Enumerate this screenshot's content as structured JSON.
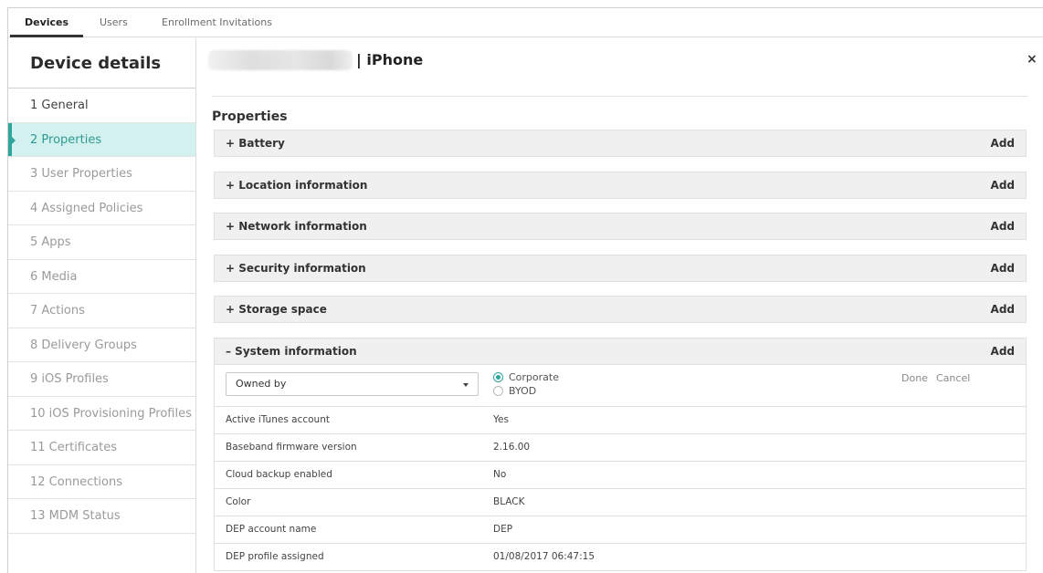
{
  "topnav": {
    "tabs": [
      "Devices",
      "Users",
      "Enrollment Invitations"
    ]
  },
  "sidebar": {
    "title": "Device details",
    "items": [
      "1 General",
      "2 Properties",
      "3 User Properties",
      "4 Assigned Policies",
      "5 Apps",
      "6 Media",
      "7 Actions",
      "8 Delivery Groups",
      "9 iOS Profiles",
      "10 iOS Provisioning Profiles",
      "11 Certificates",
      "12 Connections",
      "13 MDM Status"
    ]
  },
  "header": {
    "title": "| iPhone",
    "close": "×"
  },
  "properties": {
    "title": "Properties",
    "add_label": "Add",
    "sections": [
      "+ Battery",
      "+ Location information",
      "+ Network information",
      "+ Security information",
      "+ Storage space",
      "– System information"
    ],
    "edit": {
      "select_value": "Owned by",
      "radio": [
        "Corporate",
        "BYOD"
      ],
      "done": "Done",
      "cancel": "Cancel"
    },
    "rows": [
      {
        "key": "Active iTunes account",
        "value": "Yes"
      },
      {
        "key": "Baseband firmware version",
        "value": "2.16.00"
      },
      {
        "key": "Cloud backup enabled",
        "value": "No"
      },
      {
        "key": "Color",
        "value": "BLACK"
      },
      {
        "key": "DEP account name",
        "value": "DEP"
      },
      {
        "key": "DEP profile assigned",
        "value": "01/08/2017 06:47:15"
      }
    ]
  },
  "colors": {
    "accent": "#2fa59b",
    "active_bg": "#d3f1ee"
  }
}
